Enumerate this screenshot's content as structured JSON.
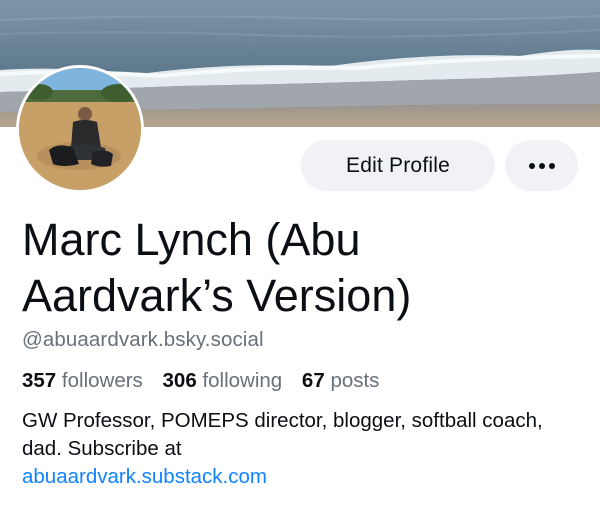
{
  "banner": {
    "image": "beach-shoreline-photo"
  },
  "avatar": {
    "image": "person-on-beach-with-dog-photo"
  },
  "actions": {
    "edit_label": "Edit Profile",
    "more_icon": "ellipsis-icon"
  },
  "profile": {
    "display_name": "Marc Lynch (Abu Aardvark’s Version)",
    "handle": "@abuaardvark.bsky.social"
  },
  "stats": {
    "followers_count": "357",
    "followers_label": "followers",
    "following_count": "306",
    "following_label": "following",
    "posts_count": "67",
    "posts_label": "posts"
  },
  "bio": {
    "text": "GW Professor, POMEPS director, blogger, softball coach, dad.  Subscribe at",
    "link": "abuaardvark.substack.com"
  },
  "colors": {
    "link": "#1083fe",
    "secondary_text": "#68707c",
    "button_bg": "#f0f2f5"
  }
}
